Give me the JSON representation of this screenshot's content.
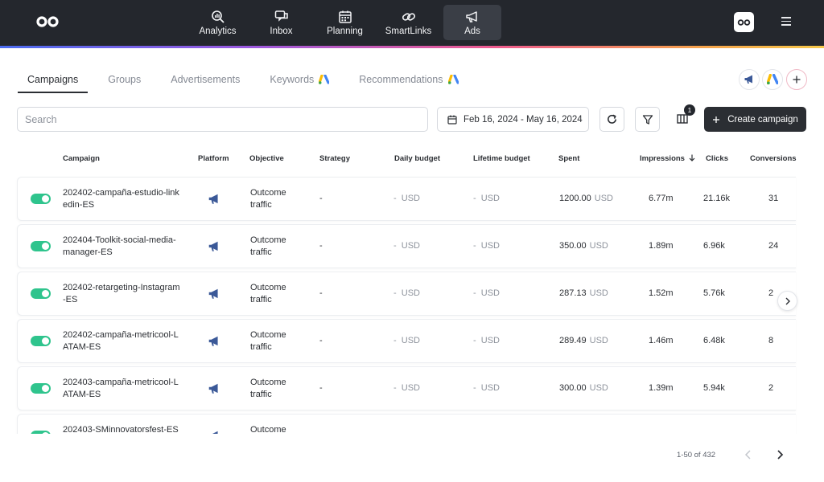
{
  "nav": {
    "items": [
      {
        "label": "Analytics",
        "icon": "analytics-icon"
      },
      {
        "label": "Inbox",
        "icon": "inbox-icon"
      },
      {
        "label": "Planning",
        "icon": "calendar-icon"
      },
      {
        "label": "SmartLinks",
        "icon": "link-icon"
      },
      {
        "label": "Ads",
        "icon": "megaphone-icon",
        "active": true
      }
    ]
  },
  "tabs": [
    {
      "label": "Campaigns",
      "active": true
    },
    {
      "label": "Groups"
    },
    {
      "label": "Advertisements"
    },
    {
      "label": "Keywords",
      "icon": "google-ads-icon"
    },
    {
      "label": "Recommendations",
      "icon": "google-ads-icon"
    }
  ],
  "toolbar": {
    "search_placeholder": "Search",
    "date_range": "Feb 16, 2024 - May 16, 2024",
    "columns_badge": "1",
    "create_label": "Create campaign"
  },
  "table": {
    "headers": {
      "campaign": "Campaign",
      "platform": "Platform",
      "objective": "Objective",
      "strategy": "Strategy",
      "daily_budget": "Daily budget",
      "lifetime_budget": "Lifetime budget",
      "spent": "Spent",
      "impressions": "Impressions",
      "clicks": "Clicks",
      "conversions": "Conversions"
    },
    "rows": [
      {
        "name": "202402-campaña-estudio-linkedin-ES",
        "objective": "Outcome traffic",
        "strategy": "-",
        "daily": "-  USD",
        "lifetime": "-  USD",
        "spent": "1200.00",
        "currency": "USD",
        "impressions": "6.77m",
        "clicks": "21.16k",
        "conversions": "31"
      },
      {
        "name": "202404-Toolkit-social-media-manager-ES",
        "objective": "Outcome traffic",
        "strategy": "-",
        "daily": "-  USD",
        "lifetime": "-  USD",
        "spent": "350.00",
        "currency": "USD",
        "impressions": "1.89m",
        "clicks": "6.96k",
        "conversions": "24"
      },
      {
        "name": "202402-retargeting-Instagram-ES",
        "objective": "Outcome traffic",
        "strategy": "-",
        "daily": "-  USD",
        "lifetime": "-  USD",
        "spent": "287.13",
        "currency": "USD",
        "impressions": "1.52m",
        "clicks": "5.76k",
        "conversions": "2"
      },
      {
        "name": "202402-campaña-metricool-LATAM-ES",
        "objective": "Outcome traffic",
        "strategy": "-",
        "daily": "-  USD",
        "lifetime": "-  USD",
        "spent": "289.49",
        "currency": "USD",
        "impressions": "1.46m",
        "clicks": "6.48k",
        "conversions": "8"
      },
      {
        "name": "202403-campaña-metricool-LATAM-ES",
        "objective": "Outcome traffic",
        "strategy": "-",
        "daily": "-  USD",
        "lifetime": "-  USD",
        "spent": "300.00",
        "currency": "USD",
        "impressions": "1.39m",
        "clicks": "5.94k",
        "conversions": "2"
      },
      {
        "name": "202403-SMinnovatorsfest-ES",
        "objective": "Outcome",
        "strategy": "",
        "daily": "",
        "lifetime": "",
        "spent": "",
        "currency": "",
        "impressions": "",
        "clicks": "",
        "conversions": ""
      }
    ]
  },
  "pagination": {
    "text": "1-50 of 432"
  },
  "colors": {
    "topbar": "#24272d",
    "toggle_on": "#2fc48d",
    "primary_button": "#2b2e33",
    "facebook_blue": "#3b5998"
  }
}
